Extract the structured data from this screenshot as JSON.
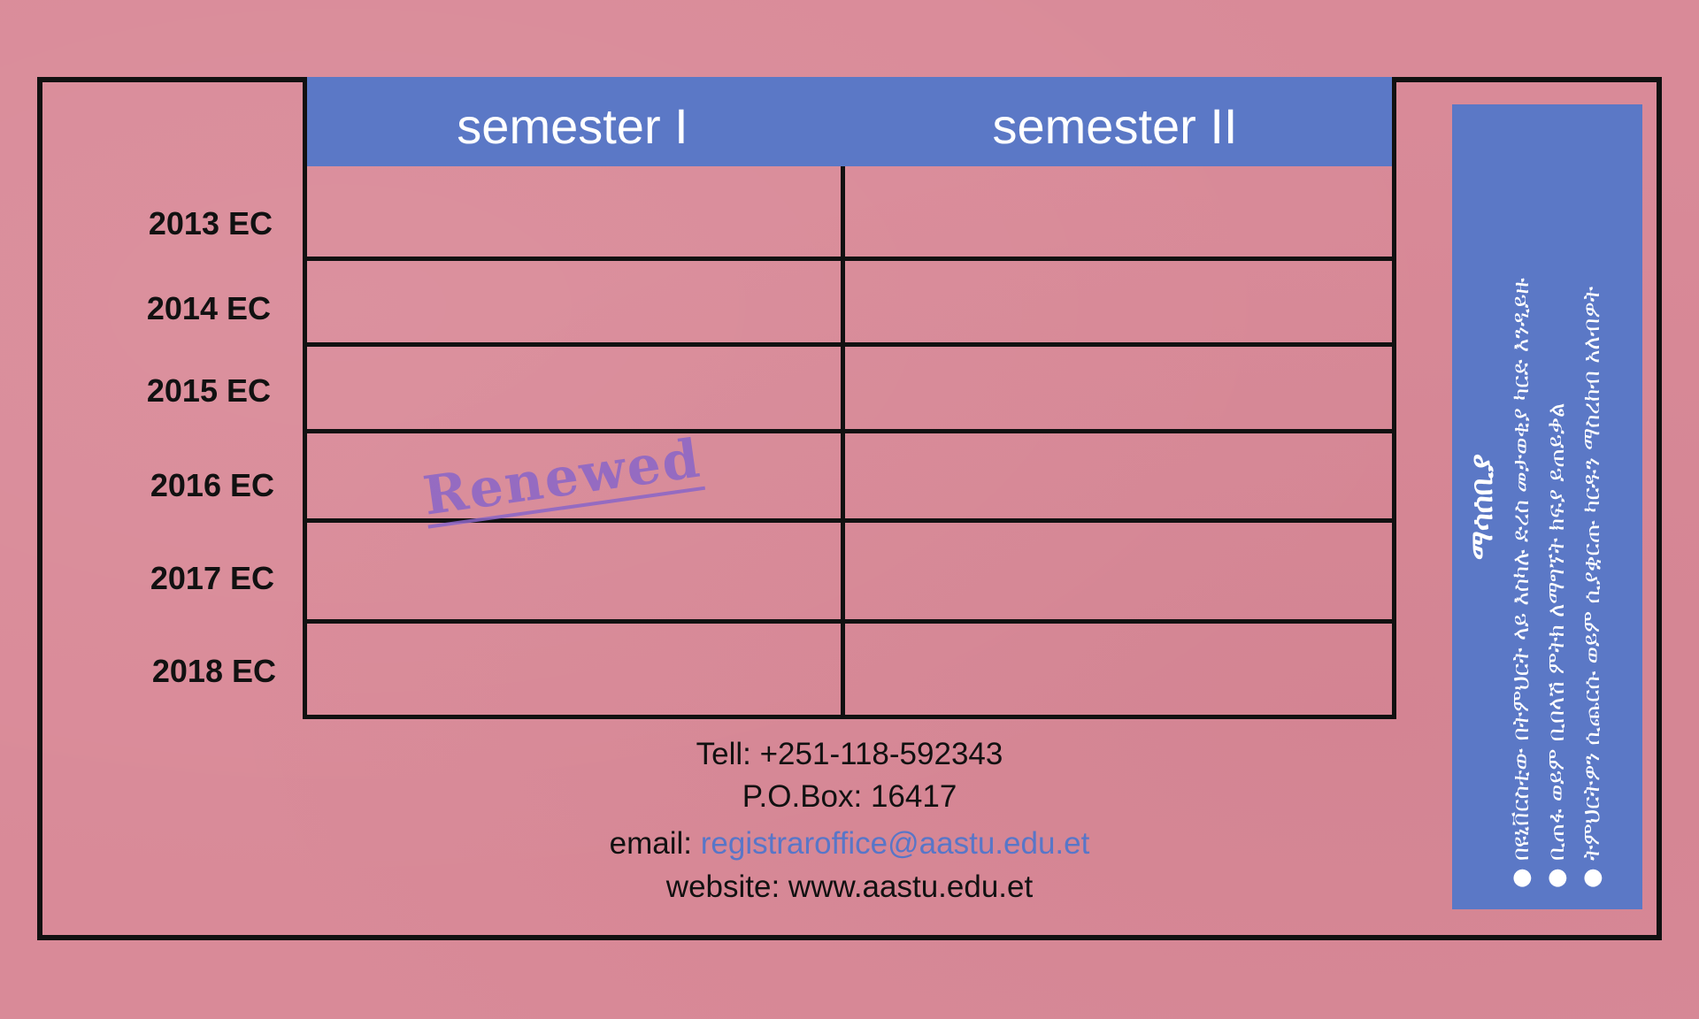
{
  "table": {
    "columns": [
      "semester I",
      "semester II"
    ],
    "rows": [
      "2013 EC",
      "2014 EC",
      "2015 EC",
      "2016 EC",
      "2017 EC",
      "2018 EC"
    ],
    "stamp": "Renewed"
  },
  "contact": {
    "phone": "Tell: +251-118-592343",
    "pobox": "P.O.Box: 16417",
    "email_label": "email:",
    "email": "registraroffice@aastu.edu.et",
    "website": "website: www.aastu.edu.et"
  },
  "notice": {
    "title": "ማሳሰቢያ",
    "items": [
      "● በዩኒቨርስቲው በትምህርት ላይ እስካሉ ድረስ መታወቂያ ካርድ እንዲይዙ",
      "● ቢጠፋ ወይም ቢበላሽ ምትክ ለማግኘት ክፍያ ይጠይቃል",
      "● ትምህርትዎን ሲጨርሱ ወይም ሲያቋርጡ ካርዱን ማስረከብ አለብዎት"
    ]
  },
  "colors": {
    "background": "#d98a98",
    "header": "#5b78c6",
    "link": "#5876c8",
    "stamp": "#8a66c8"
  }
}
